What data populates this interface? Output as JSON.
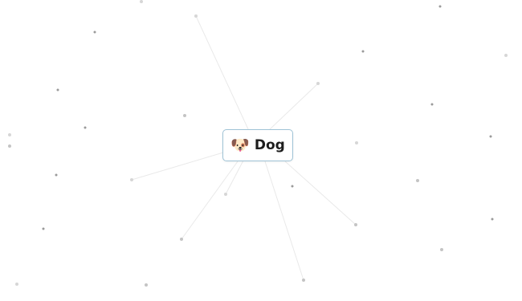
{
  "element": {
    "emoji": "🐶",
    "name": "Dog"
  }
}
